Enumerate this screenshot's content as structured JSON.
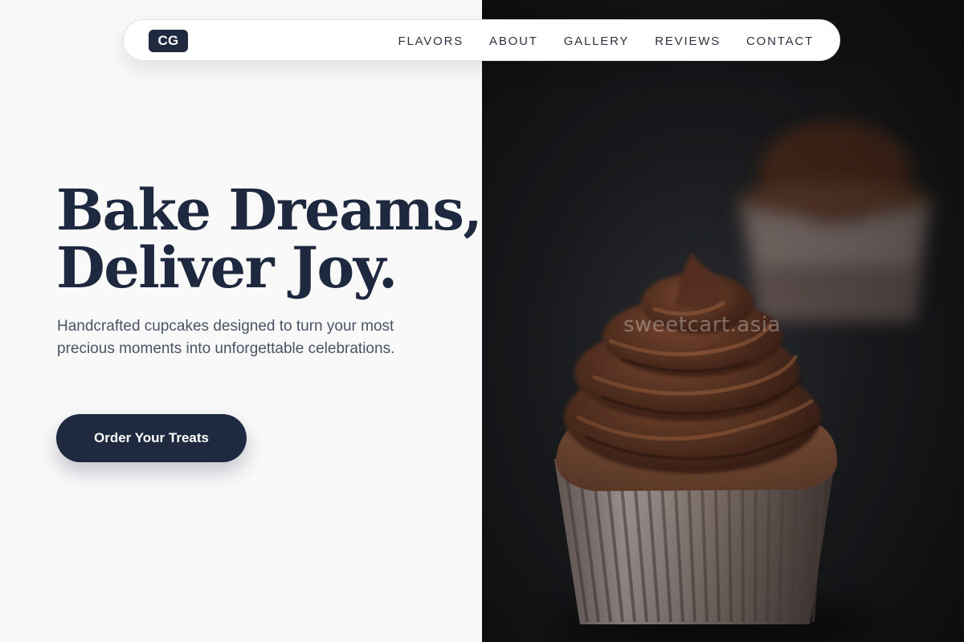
{
  "brand": {
    "logo_text": "CG"
  },
  "nav": {
    "items": [
      {
        "label": "FLAVORS"
      },
      {
        "label": "ABOUT"
      },
      {
        "label": "GALLERY"
      },
      {
        "label": "REVIEWS"
      },
      {
        "label": "CONTACT"
      }
    ]
  },
  "hero": {
    "title_line1": "Bake Dreams,",
    "title_line2": "Deliver Joy.",
    "subtitle": "Handcrafted cupcakes designed to turn your most precious moments into unforgettable celebrations.",
    "cta_label": "Order Your Treats"
  },
  "image": {
    "watermark": "sweetcart.asia",
    "subject": "chocolate-cupcake-photo"
  },
  "colors": {
    "primary_navy": "#1f2a40",
    "page_background": "#f9f9f9",
    "body_text": "#4a5466",
    "photo_background": "#1d1f22",
    "frosting": "#5a3322",
    "cake": "#6e4632"
  }
}
